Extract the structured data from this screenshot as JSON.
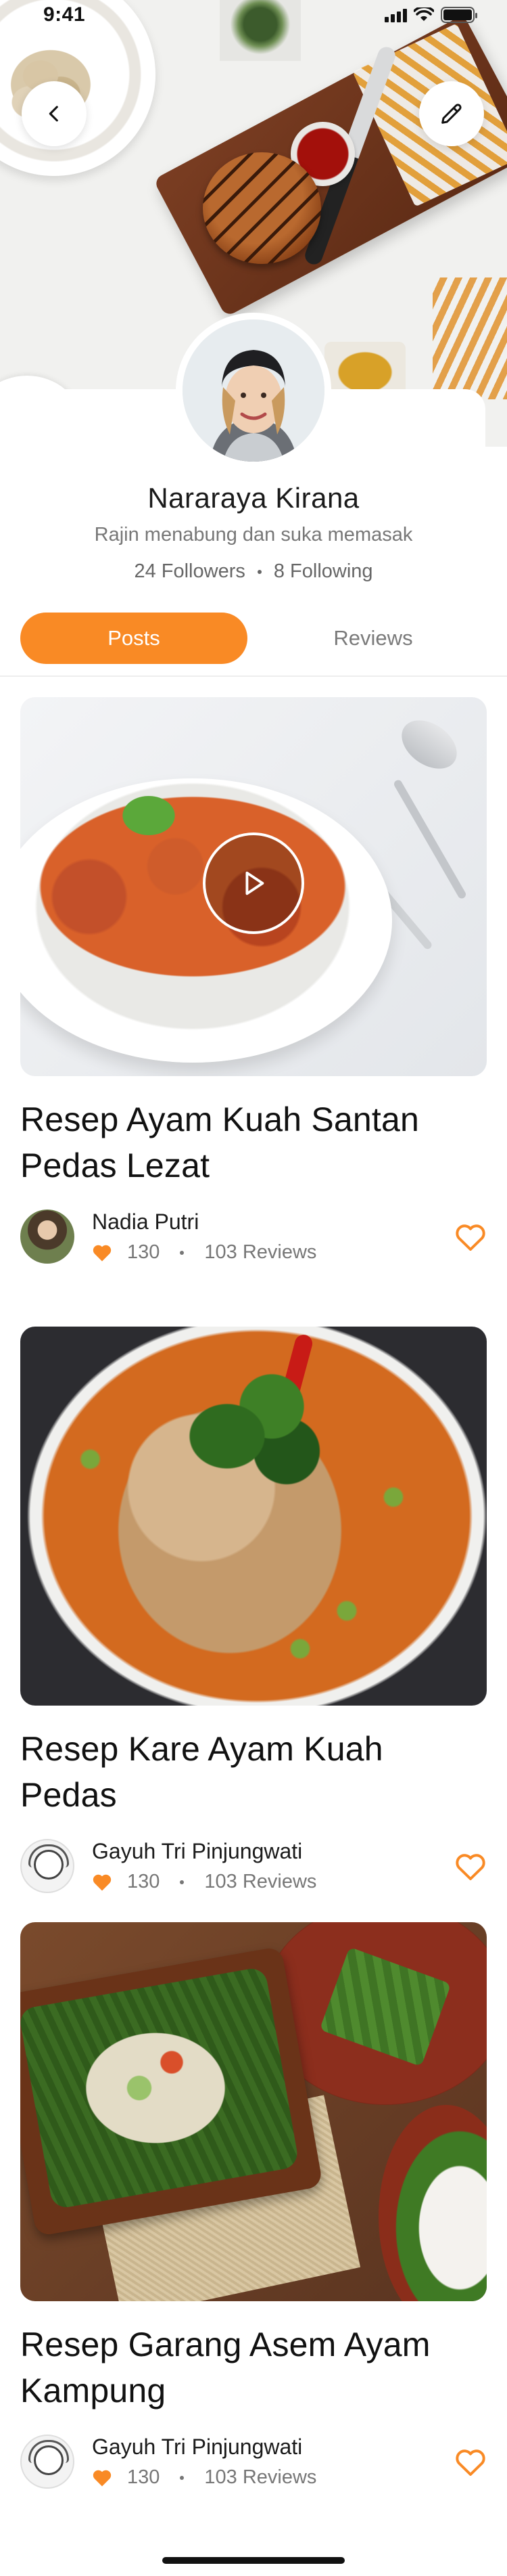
{
  "status_bar": {
    "time": "9:41"
  },
  "header": {
    "back_icon": "chevron-left-icon",
    "edit_icon": "pencil-icon"
  },
  "profile": {
    "name": "Nararaya Kirana",
    "bio": "Rajin menabung dan suka memasak",
    "followers": "24 Followers",
    "following": "8 Following"
  },
  "tabs": [
    {
      "label": "Posts",
      "active": true
    },
    {
      "label": "Reviews",
      "active": false
    }
  ],
  "colors": {
    "accent": "#f98a25",
    "text_primary": "#111111",
    "text_secondary": "#777777"
  },
  "posts": [
    {
      "title": "Resep Ayam Kuah Santan Pedas Lezat",
      "has_video": true,
      "author": "Nadia Putri",
      "likes": "130",
      "reviews": "103 Reviews"
    },
    {
      "title": "Resep Kare Ayam Kuah Pedas",
      "has_video": false,
      "author": "Gayuh Tri Pinjungwati",
      "likes": "130",
      "reviews": "103 Reviews"
    },
    {
      "title": "Resep Garang Asem Ayam Kampung",
      "has_video": false,
      "author": "Gayuh Tri Pinjungwati",
      "likes": "130",
      "reviews": "103 Reviews"
    }
  ]
}
